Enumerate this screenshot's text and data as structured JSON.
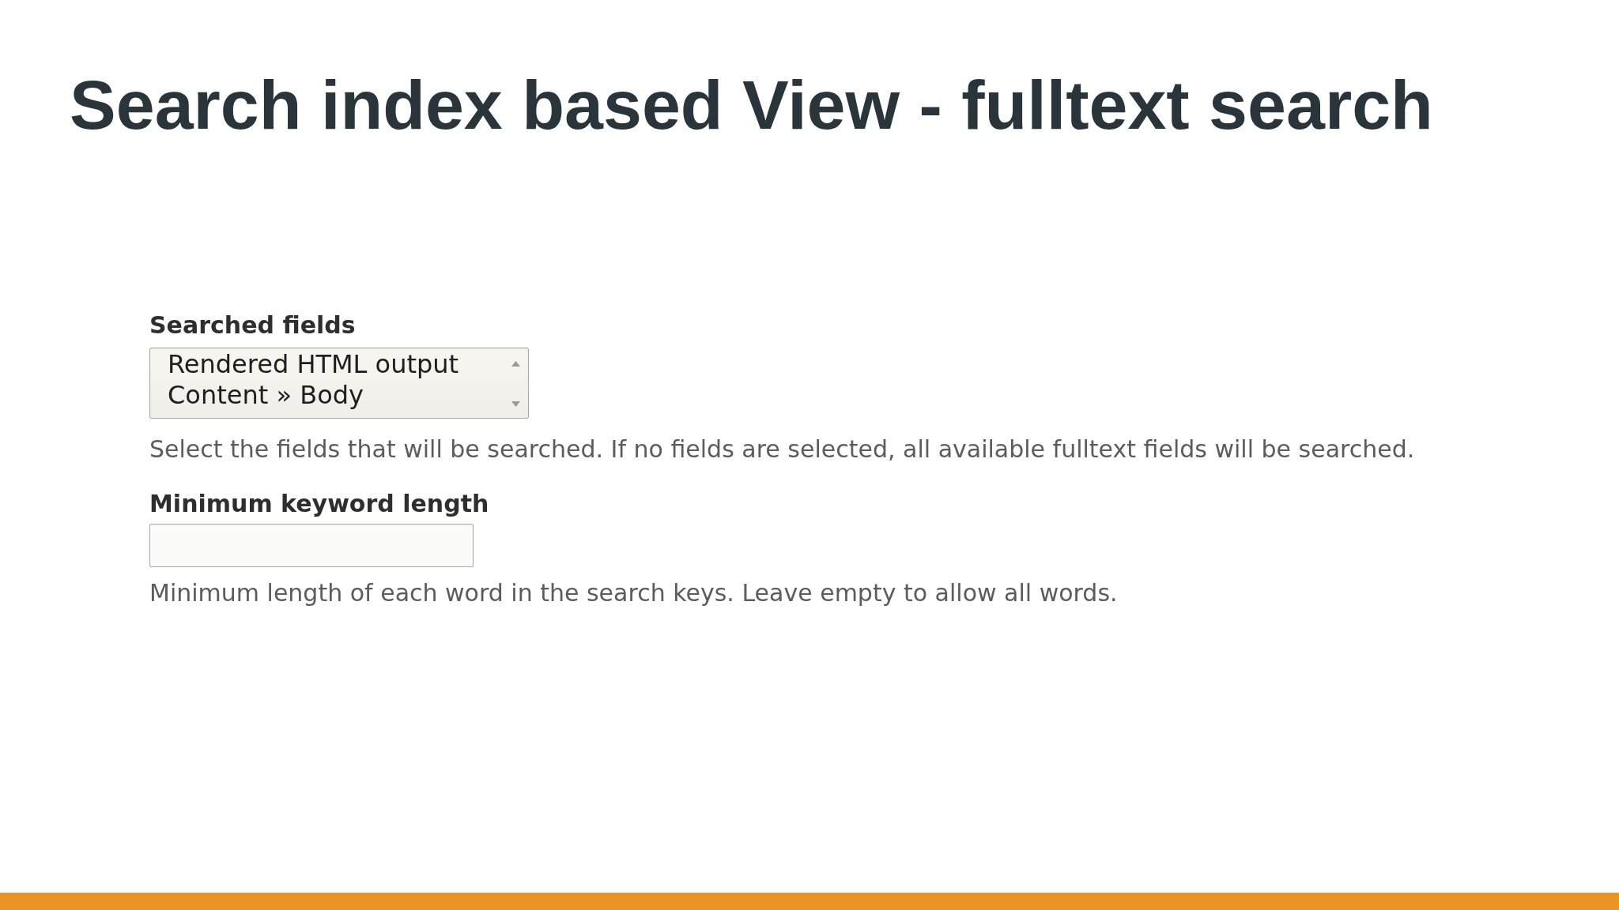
{
  "title": "Search index based View - fulltext search",
  "form": {
    "fields": [
      {
        "kind": "multiselect",
        "label": "Searched fields",
        "options": [
          {
            "label": "Rendered HTML output",
            "selected": false
          },
          {
            "label": "Content » Body",
            "selected": false
          }
        ],
        "description": "Select the fields that will be searched. If no fields are selected, all available fulltext fields will be searched."
      },
      {
        "kind": "textfield",
        "label": "Minimum keyword length",
        "description": "Minimum length of each word in the search keys. Leave empty to allow all words."
      }
    ]
  }
}
